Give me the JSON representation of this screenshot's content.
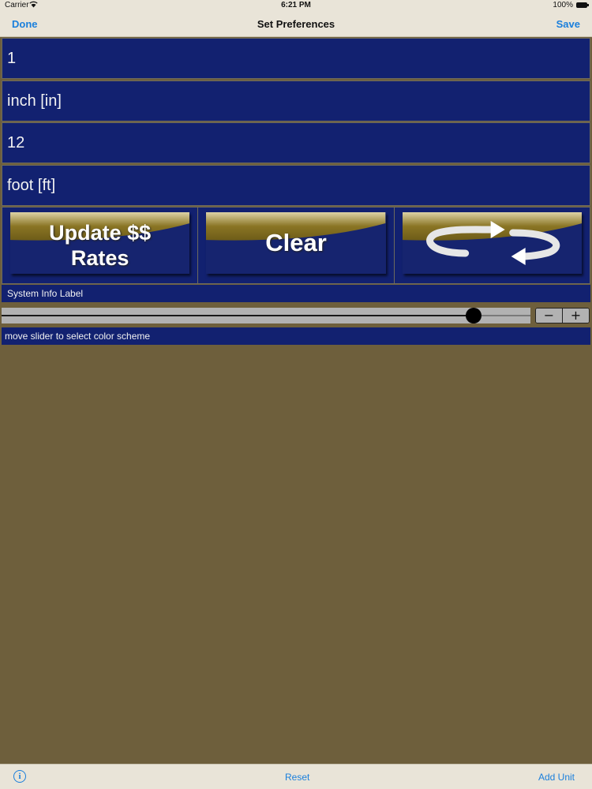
{
  "status_bar": {
    "carrier": "Carrier",
    "wifi_icon": "wifi-icon",
    "time": "6:21 PM",
    "battery": "100%"
  },
  "nav": {
    "done_label": "Done",
    "title": "Set Preferences",
    "save_label": "Save"
  },
  "fields": {
    "from_value": "1",
    "from_unit": "inch [in]",
    "to_value": "12",
    "to_unit": "foot [ft]"
  },
  "buttons": {
    "update_line1": "Update $$",
    "update_line2": "Rates",
    "clear": "Clear",
    "swap_icon": "swap-arrows-icon"
  },
  "system_info": "System Info Label",
  "slider": {
    "value_fraction": 0.905,
    "minus_label": "−",
    "plus_label": "+",
    "caption": "move slider to select color scheme"
  },
  "bottom_bar": {
    "info_icon": "info-icon",
    "info_glyph": "i",
    "reset_label": "Reset",
    "add_unit_label": "Add Unit"
  },
  "colors": {
    "field_bg": "#122170",
    "background": "#6e5f3c",
    "bar_bg": "#e9e4d8",
    "accent": "#1a7fdc",
    "button_gold": "#8a7524"
  }
}
